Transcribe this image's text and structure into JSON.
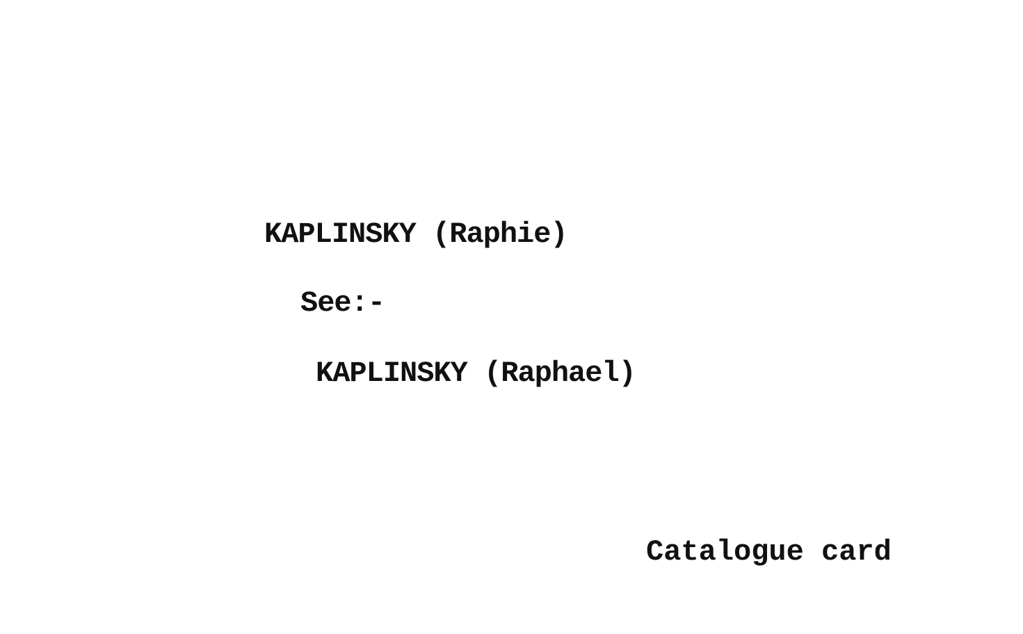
{
  "card": {
    "heading": "KAPLINSKY (Raphie)",
    "see_label": "See:-",
    "reference": "KAPLINSKY (Raphael)",
    "footer_label": "Catalogue card"
  }
}
